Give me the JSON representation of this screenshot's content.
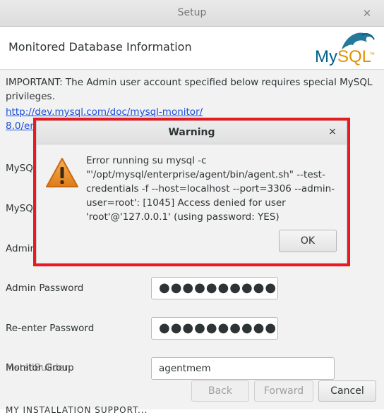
{
  "window": {
    "title": "Setup",
    "close_glyph": "✕"
  },
  "header": {
    "title": "Monitored Database Information",
    "logo_text": "MySQL",
    "logo_tm": "™"
  },
  "main": {
    "important_text": "IMPORTANT: The Admin user account specified below requires special MySQL privileges.",
    "link_line1": "http://dev.mysql.com/doc/mysql-monitor/",
    "link_line2": "8.0/en",
    "labels": {
      "mysql_a": "MySQ",
      "mysql_b": "MySQ",
      "admin_user": "Admin",
      "admin_password": "Admin Password",
      "reenter_password": "Re-enter Password",
      "monitor_group": "Monitor Group",
      "overlap_ghost": "InstallBuilder"
    },
    "fields": {
      "admin_password_value": "●●●●●●●●●●",
      "reenter_password_value": "●●●●●●●●●●",
      "monitor_group_value": "agentmem"
    },
    "buttons": {
      "back": "Back",
      "forward": "Forward",
      "cancel": "Cancel"
    },
    "bottom_cut_text": "MY INSTALLATION SUPPORT..."
  },
  "dialog": {
    "title": "Warning",
    "close_glyph": "×",
    "icon": "warning-triangle-icon",
    "message": "Error running su mysql -c \"'/opt/mysql/enterprise/agent/bin/agent.sh\" --test-credentials -f --host=localhost --port=3306  --admin-user=root': [1045] Access denied for user 'root'@'127.0.0.1' (using password: YES)",
    "ok_label": "OK",
    "highlight_color": "#e8191f"
  },
  "colors": {
    "link": "#1a4fd6",
    "logo_blue": "#00618a",
    "logo_orange": "#e48e00",
    "warning_orange": "#f08a24"
  }
}
